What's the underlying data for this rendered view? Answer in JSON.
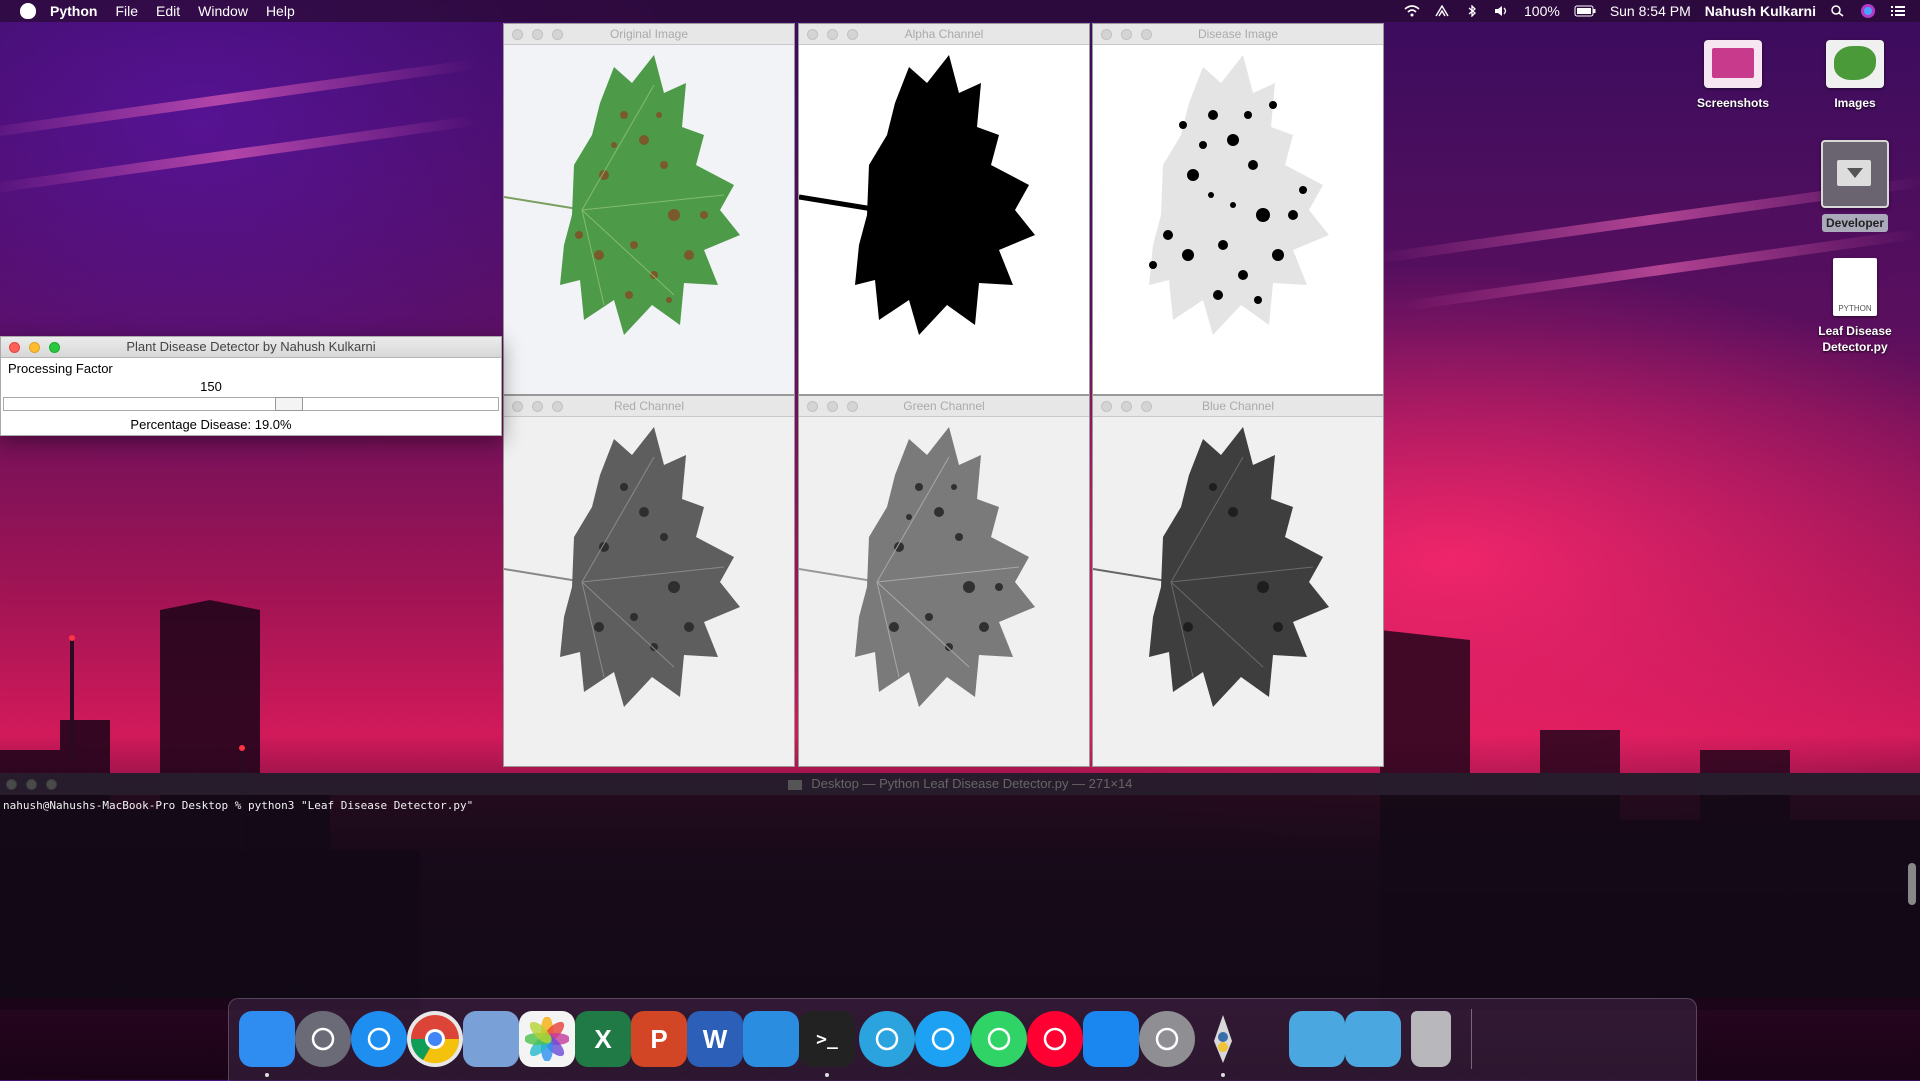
{
  "menubar": {
    "app": "Python",
    "items": [
      "File",
      "Edit",
      "Window",
      "Help"
    ],
    "battery": "100%",
    "clock": "Sun 8:54 PM",
    "user": "Nahush Kulkarni"
  },
  "desktop": {
    "icons": [
      {
        "label": "Screenshots"
      },
      {
        "label": "Images"
      },
      {
        "label": "Developer"
      },
      {
        "label": "Leaf Disease Detector.py",
        "badge": "PYTHON"
      }
    ]
  },
  "windows": {
    "original": {
      "title": "Original Image"
    },
    "alpha": {
      "title": "Alpha Channel"
    },
    "disease": {
      "title": "Disease Image"
    },
    "red": {
      "title": "Red Channel"
    },
    "green": {
      "title": "Green Channel"
    },
    "blue": {
      "title": "Blue Channel"
    }
  },
  "detector": {
    "title": "Plant Disease Detector by Nahush Kulkarni",
    "factor_label": "Processing Factor",
    "factor_value": "150",
    "slider_level": 0.58,
    "result": "Percentage Disease: 19.0%"
  },
  "terminal": {
    "title": "Desktop — Python Leaf Disease Detector.py — 271×14",
    "line": "nahush@Nahushs-MacBook-Pro Desktop % python3 \"Leaf Disease Detector.py\""
  },
  "dock": {
    "apps": [
      {
        "name": "finder",
        "glyph": "",
        "color": "#2f8cf0"
      },
      {
        "name": "launchpad",
        "glyph": "",
        "color": "#6b6b78"
      },
      {
        "name": "safari",
        "glyph": "",
        "color": "#1e8ef0"
      },
      {
        "name": "chrome",
        "glyph": "",
        "color": "#e8e8e8"
      },
      {
        "name": "preview",
        "glyph": "",
        "color": "#7aa0d8"
      },
      {
        "name": "photos",
        "glyph": "",
        "color": "#f4f4f4"
      },
      {
        "name": "excel",
        "glyph": "X",
        "color": "#1f7a45"
      },
      {
        "name": "powerpoint",
        "glyph": "P",
        "color": "#d24626"
      },
      {
        "name": "word",
        "glyph": "W",
        "color": "#2b5fb8"
      },
      {
        "name": "vscode",
        "glyph": "",
        "color": "#2a8de0"
      },
      {
        "name": "terminal",
        "glyph": ">_",
        "color": "#222222"
      },
      {
        "name": "telegram",
        "glyph": "",
        "color": "#2aa3df"
      },
      {
        "name": "twitter",
        "glyph": "",
        "color": "#1da1f2"
      },
      {
        "name": "whatsapp",
        "glyph": "",
        "color": "#2fd366"
      },
      {
        "name": "youtube",
        "glyph": "",
        "color": "#ff0033"
      },
      {
        "name": "app-store",
        "glyph": "",
        "color": "#1a86f0"
      },
      {
        "name": "system-preferences",
        "glyph": "",
        "color": "#8e8e93"
      },
      {
        "name": "python-launcher",
        "glyph": "",
        "color": "transparent"
      },
      {
        "name": "downloads",
        "glyph": "",
        "color": "#4ba7e0"
      },
      {
        "name": "applications",
        "glyph": "",
        "color": "#4ba7e0"
      },
      {
        "name": "trash",
        "glyph": "",
        "color": "#b8b8bc"
      }
    ]
  }
}
